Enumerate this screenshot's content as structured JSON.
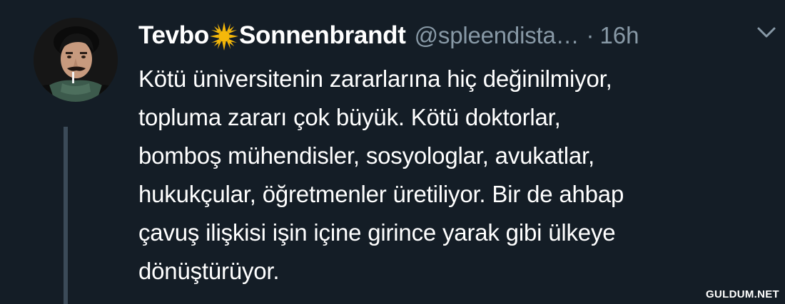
{
  "tweet": {
    "display_name_part1": "Tevbo",
    "display_name_part2": "Sonnenbrandt",
    "name_emoji": "sun-icon",
    "handle": "@spleendista…",
    "separator": "·",
    "timestamp": "16h",
    "menu_icon": "chevron-down-icon",
    "text_lines": [
      "Kötü üniversitenin zararlarına hiç değinilmiyor,",
      "topluma zararı çok büyük. Kötü doktorlar,",
      "bomboş mühendisler, sosyologlar, avukatlar,",
      "hukukçular, öğretmenler üretiliyor. Bir de ahbap",
      "çavuş ilişkisi işin içine girince yarak gibi ülkeye",
      "dönüştürüyor."
    ]
  },
  "watermark": "GULDUM.NET",
  "colors": {
    "background": "#141d26",
    "text": "#ffffff",
    "secondary_text": "#8899a6",
    "thread_line": "#3b4a58",
    "sun": "#f5b80a"
  }
}
